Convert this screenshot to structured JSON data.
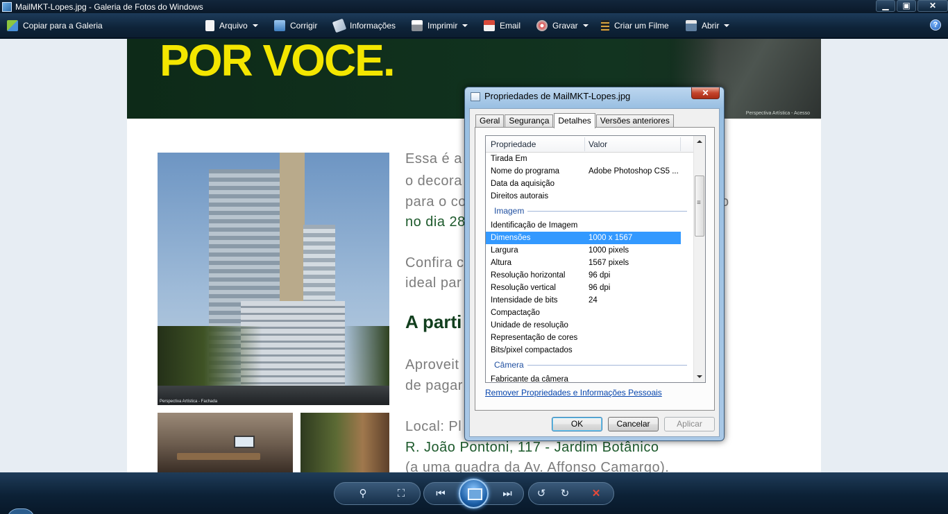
{
  "window": {
    "title": "MailMKT-Lopes.jpg - Galeria de Fotos do Windows",
    "minimize": "▁",
    "restore": "▣",
    "close": "✕"
  },
  "toolbar": {
    "copy_to_gallery": "Copiar para a Galeria",
    "arquivo": "Arquivo",
    "corrigir": "Corrigir",
    "informacoes": "Informações",
    "imprimir": "Imprimir",
    "email": "Email",
    "gravar": "Gravar",
    "criar_filme": "Criar um Filme",
    "abrir": "Abrir",
    "help": "?"
  },
  "photo": {
    "banner_text": "POR VOCE.",
    "banner_caption": "Perspectiva Artística - Acesso",
    "building_caption": "Perspectiva Artística - Fachada",
    "lines": [
      "Essa é a",
      "o decora",
      "para o co",
      "no dia 28",
      "Confira c",
      "ideal par",
      "A parti",
      "Aproveit",
      "de pagar",
      "Local: Pl",
      "R. João Pontoni, 117 - Jardim Botânico",
      "(a uma quadra da Av. Affonso Camargo)."
    ],
    "trailing_o": "o"
  },
  "dialog": {
    "title": "Propriedades de MailMKT-Lopes.jpg",
    "close": "✕",
    "tabs": [
      "Geral",
      "Segurança",
      "Detalhes",
      "Versões anteriores"
    ],
    "active_tab": "Detalhes",
    "columns": {
      "property": "Propriedade",
      "value": "Valor"
    },
    "rows_top": [
      {
        "p": "Tirada Em",
        "v": ""
      },
      {
        "p": "Nome do programa",
        "v": "Adobe Photoshop CS5 ..."
      },
      {
        "p": "Data da aquisição",
        "v": ""
      },
      {
        "p": "Direitos autorais",
        "v": ""
      }
    ],
    "group_image": "Imagem",
    "rows_image": [
      {
        "p": "Identificação de Imagem",
        "v": ""
      },
      {
        "p": "Dimensões",
        "v": "1000 x 1567",
        "selected": true
      },
      {
        "p": "Largura",
        "v": "1000 pixels"
      },
      {
        "p": "Altura",
        "v": "1567 pixels"
      },
      {
        "p": "Resolução horizontal",
        "v": "96 dpi"
      },
      {
        "p": "Resolução vertical",
        "v": "96 dpi"
      },
      {
        "p": "Intensidade de bits",
        "v": "24"
      },
      {
        "p": "Compactação",
        "v": ""
      },
      {
        "p": "Unidade de resolução",
        "v": ""
      },
      {
        "p": "Representação de cores",
        "v": ""
      },
      {
        "p": "Bits/pixel compactados",
        "v": ""
      }
    ],
    "group_camera": "Câmera",
    "rows_camera": [
      {
        "p": "Fabricante da câmera",
        "v": ""
      }
    ],
    "remove_link": "Remover Propriedades e Informações Pessoais",
    "ok": "OK",
    "cancel": "Cancelar",
    "apply": "Aplicar"
  },
  "player": {
    "zoom": "⚲",
    "fit": "⛶",
    "prev": "⏮",
    "next": "⏭",
    "rotate_ccw": "↺",
    "rotate_cw": "↻",
    "delete": "✕"
  },
  "colors": {
    "chrome_dark": "#0b1b2e",
    "selection": "#3399ff",
    "banner_yellow": "#f3e600",
    "brand_green": "#1d5a2c"
  }
}
